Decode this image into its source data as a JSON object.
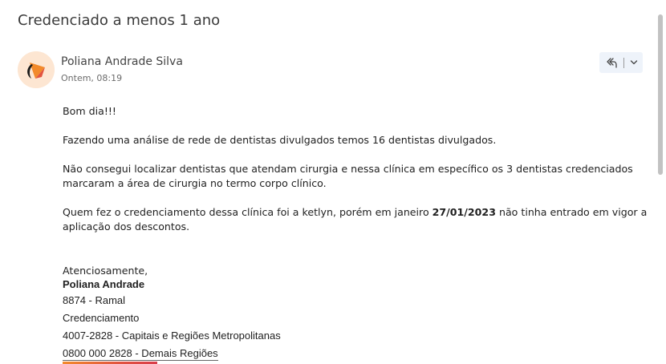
{
  "message": {
    "subject": "Credenciado a menos 1 ano",
    "sender": {
      "name": "Poliana Andrade Silva",
      "time": "Ontem, 08:19"
    },
    "body": {
      "greeting": "Bom dia!!!",
      "para1": "Fazendo uma análise de rede de dentistas divulgados temos 16 dentistas divulgados.",
      "para2": "Não consegui localizar dentistas que atendam cirurgia e nessa clínica em específico os 3 dentistas credenciados marcaram a área de cirurgia no termo corpo clínico.",
      "para3_before": "Quem fez o credenciamento dessa clínica foi a ketlyn, porém em janeiro ",
      "para3_date": "27/01/2023",
      "para3_after": " não tinha entrado em vigor a aplicação dos descontos."
    },
    "signature": {
      "closing": "Atenciosamente,",
      "name": "Poliana Andrade",
      "extension": "8874 - Ramal",
      "department": "Credenciamento",
      "phone_capitals": "4007-2828 - Capitais e Regiões Metropolitanas",
      "phone_other": "0800 000 2828 - Demais Regiões"
    }
  },
  "icons": {
    "reply_all": "reply-all-icon",
    "more": "chevron-down-icon",
    "avatar": "company-logo"
  },
  "colors": {
    "avatar_bg": "#fde6d2",
    "action_bg": "#eef3fa",
    "accent_orange": "#f28a2b"
  }
}
